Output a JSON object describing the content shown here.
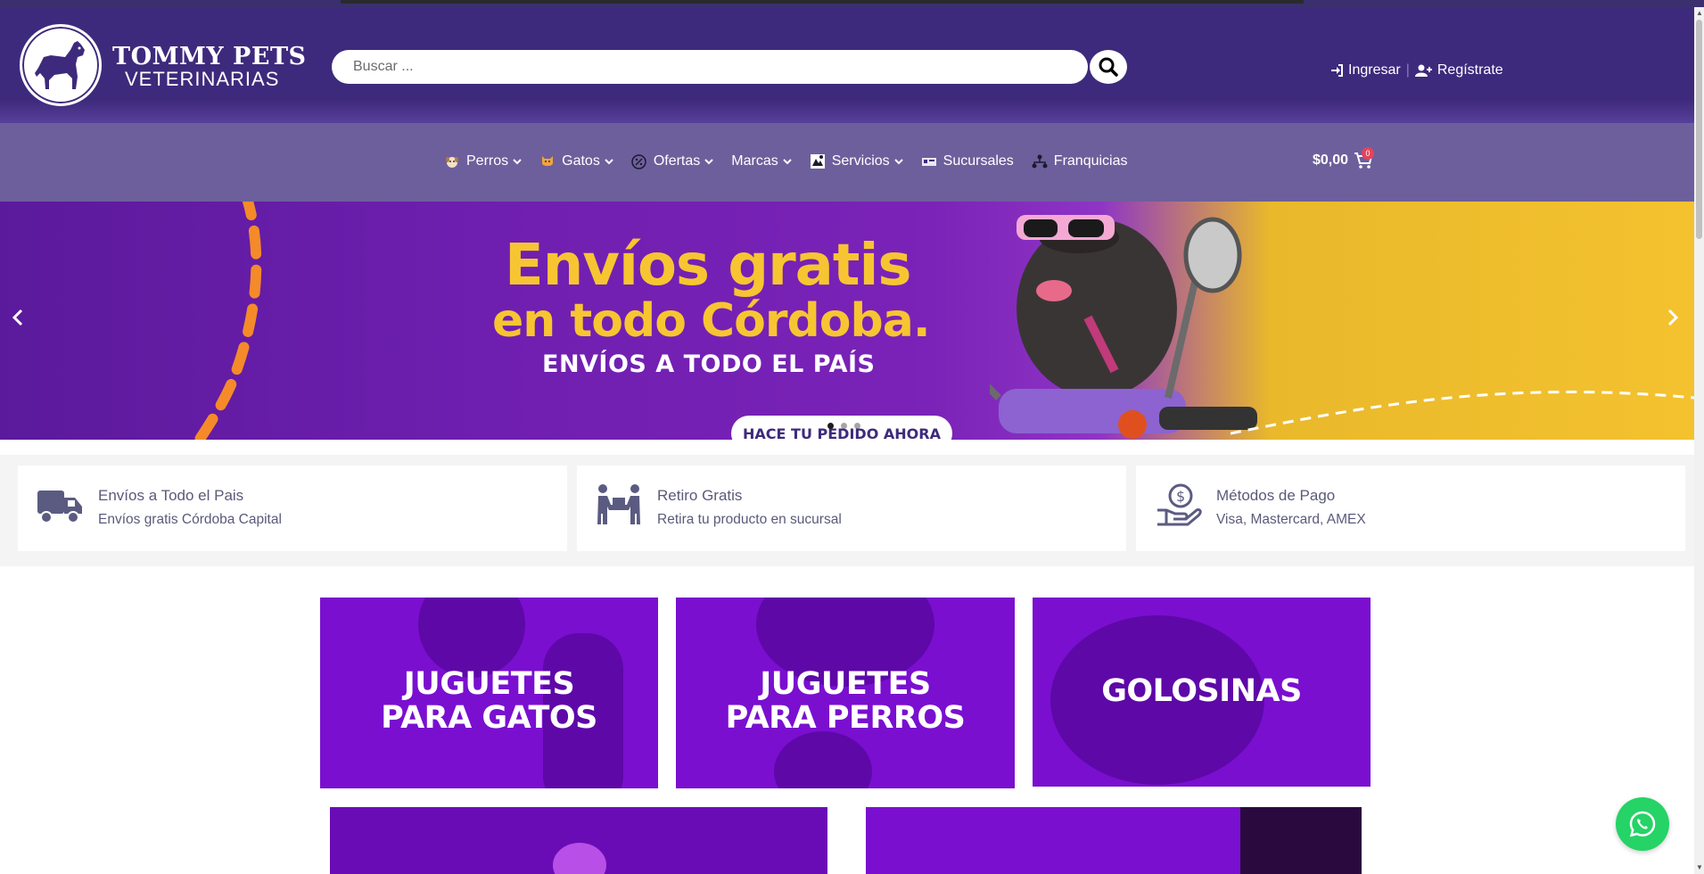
{
  "brand": {
    "name_line1": "TOMMY PETS",
    "name_line2": "VETERINARIAS"
  },
  "search": {
    "placeholder": "Buscar ..."
  },
  "account": {
    "login": "Ingresar",
    "register": "Regístrate",
    "separator": "|"
  },
  "nav": {
    "items": [
      {
        "label": "Perros",
        "icon": "dog-icon",
        "dropdown": true
      },
      {
        "label": "Gatos",
        "icon": "cat-icon",
        "dropdown": true
      },
      {
        "label": "Ofertas",
        "icon": "percent-icon",
        "dropdown": true
      },
      {
        "label": "Marcas",
        "icon": "",
        "dropdown": true
      },
      {
        "label": "Servicios",
        "icon": "services-icon",
        "dropdown": true
      },
      {
        "label": "Sucursales",
        "icon": "store-icon",
        "dropdown": false
      },
      {
        "label": "Franquicias",
        "icon": "network-icon",
        "dropdown": false
      }
    ]
  },
  "cart": {
    "total": "$0,00",
    "count": "0"
  },
  "hero": {
    "line1": "Envíos gratis",
    "line2": "en todo Córdoba.",
    "line3": "ENVÍOS A TODO EL PAÍS",
    "cta": "HACE TU PEDIDO AHORA",
    "slides": 3,
    "active_slide": 1
  },
  "features": [
    {
      "title": "Envíos a Todo el Pais",
      "subtitle": "Envíos gratis Córdoba Capital",
      "icon": "truck-icon"
    },
    {
      "title": "Retiro Gratis",
      "subtitle": "Retira tu producto en sucursal",
      "icon": "pickup-icon"
    },
    {
      "title": "Métodos de Pago",
      "subtitle": "Visa, Mastercard, AMEX",
      "icon": "payment-hand-icon"
    }
  ],
  "categories": [
    {
      "line1": "JUGUETES",
      "line2": "PARA GATOS"
    },
    {
      "line1": "JUGUETES",
      "line2": "PARA PERROS"
    },
    {
      "line1": "GOLOSINAS",
      "line2": ""
    }
  ],
  "colors": {
    "header": "#3e2a7c",
    "navbar": "#6d5f9c",
    "accent_yellow": "#f7c531",
    "category_purple": "#7a0fd0",
    "whatsapp": "#25d366"
  }
}
